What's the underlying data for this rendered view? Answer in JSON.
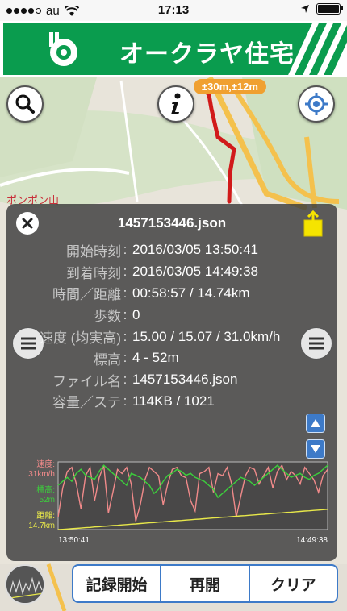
{
  "status_bar": {
    "carrier": "au",
    "time": "17:13"
  },
  "banner": {
    "company_name": "オークラヤ住宅"
  },
  "map": {
    "accuracy_badge": "±30m,±12m",
    "labels": {
      "mountain": "ポンポン山"
    }
  },
  "panel": {
    "title": "1457153446.json",
    "rows": [
      {
        "label": "開始時刻",
        "value": "2016/03/05 13:50:41"
      },
      {
        "label": "到着時刻",
        "value": "2016/03/05 14:49:38"
      },
      {
        "label": "時間／距離",
        "value": "00:58:57 / 14.74km"
      },
      {
        "label": "歩数",
        "value": "0"
      },
      {
        "label": "速度 (均実高)",
        "value": "15.00 / 15.07 / 31.0km/h"
      },
      {
        "label": "標高",
        "value": "4 - 52m"
      },
      {
        "label": "ファイル名",
        "value": "1457153446.json"
      },
      {
        "label": "容量／ステ",
        "value": "114KB / 1021"
      }
    ],
    "separator": ":"
  },
  "chart_data": {
    "type": "line",
    "x_start": "13:50:41",
    "x_end": "14:49:38",
    "series": [
      {
        "name": "速度",
        "unit_value": "31km/h",
        "color": "#f08a8a",
        "values": [
          6,
          20,
          28,
          30,
          22,
          10,
          26,
          30,
          14,
          25,
          31,
          8,
          18,
          29,
          27,
          30,
          22,
          4,
          12,
          24,
          30,
          28,
          26,
          12,
          22,
          29,
          30,
          26,
          25,
          14,
          9,
          27,
          28,
          30,
          18,
          27,
          26,
          30,
          22,
          6,
          16,
          26,
          30,
          29,
          22,
          26,
          30,
          20,
          28,
          31,
          24,
          28,
          26,
          22,
          30,
          27,
          24,
          18,
          26,
          29
        ]
      },
      {
        "name": "標高",
        "unit_value": "52m",
        "color": "#3ccf3c",
        "values": [
          22,
          24,
          26,
          24,
          28,
          30,
          27,
          26,
          25,
          29,
          32,
          30,
          28,
          26,
          24,
          22,
          28,
          27,
          26,
          24,
          22,
          18,
          20,
          24,
          27,
          28,
          30,
          29,
          27,
          28,
          26,
          25,
          24,
          22,
          20,
          16,
          18,
          20,
          22,
          24,
          26,
          25,
          24,
          22,
          24,
          26,
          28,
          30,
          32,
          30,
          28,
          26,
          27,
          28,
          26,
          25,
          27,
          28,
          30,
          32
        ]
      },
      {
        "name": "距離",
        "unit_value": "14.7km",
        "color": "#e8e84a",
        "values": [
          0,
          0.2,
          0.4,
          0.7,
          0.9,
          1.1,
          1.4,
          1.6,
          1.9,
          2.1,
          2.4,
          2.6,
          2.9,
          3.1,
          3.4,
          3.6,
          3.9,
          4.1,
          4.4,
          4.6,
          4.9,
          5.1,
          5.4,
          5.6,
          5.9,
          6.1,
          6.4,
          6.6,
          6.9,
          7.1,
          7.4,
          7.6,
          7.9,
          8.1,
          8.4,
          8.6,
          8.9,
          9.1,
          9.4,
          9.6,
          9.9,
          10.1,
          10.4,
          10.6,
          10.9,
          11.1,
          11.4,
          11.6,
          11.9,
          12.1,
          12.4,
          12.6,
          12.9,
          13.1,
          13.4,
          13.6,
          13.9,
          14.1,
          14.4,
          14.7
        ]
      }
    ]
  },
  "bottom_bar": {
    "record_start": "記録開始",
    "resume": "再開",
    "clear": "クリア"
  }
}
